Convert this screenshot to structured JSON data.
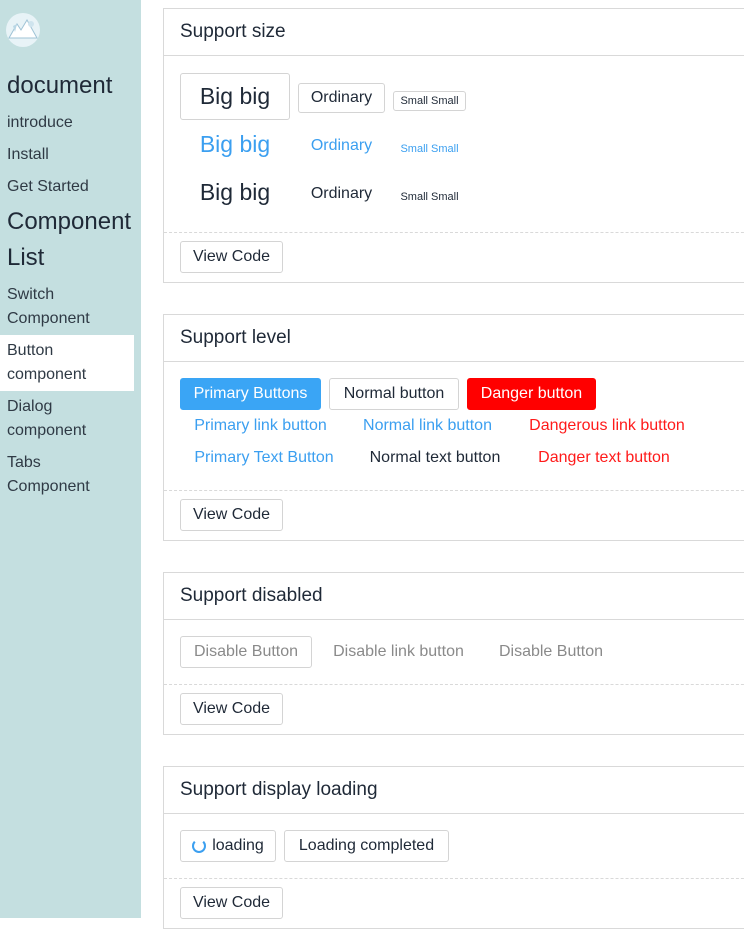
{
  "sidebar": {
    "doc_heading": "document",
    "doc_items": [
      "introduce",
      "Install",
      "Get Started"
    ],
    "comp_heading_line1": "Component",
    "comp_heading_line2": "List",
    "comp_items": [
      {
        "line1": "Switch",
        "line2": "Component"
      },
      {
        "line1": "Button",
        "line2": "component"
      },
      {
        "line1": "Dialog",
        "line2": "component"
      },
      {
        "line1": "Tabs",
        "line2": "Component"
      }
    ]
  },
  "sections": {
    "size": {
      "title": "Support size",
      "row1": [
        "Big big",
        "Ordinary",
        "Small Small"
      ],
      "row2": [
        "Big big",
        "Ordinary",
        "Small Small"
      ],
      "row3": [
        "Big big",
        "Ordinary",
        "Small Small"
      ],
      "view_code": "View Code"
    },
    "level": {
      "title": "Support level",
      "row1": [
        "Primary Buttons",
        "Normal button",
        "Danger button"
      ],
      "row2": [
        "Primary link button",
        "Normal link button",
        "Dangerous link button"
      ],
      "row3": [
        "Primary Text Button",
        "Normal text button",
        "Danger text button"
      ],
      "view_code": "View Code"
    },
    "disabled": {
      "title": "Support disabled",
      "buttons": [
        "Disable Button",
        "Disable link button",
        "Disable Button"
      ],
      "view_code": "View Code"
    },
    "loading": {
      "title": "Support display loading",
      "buttons": [
        "loading",
        "Loading completed"
      ],
      "view_code": "View Code"
    }
  },
  "colors": {
    "sidebar_bg": "#c4dfe0",
    "primary": "#3aa5f5",
    "link_blue": "#3b9ff0",
    "danger": "#ff0000"
  }
}
